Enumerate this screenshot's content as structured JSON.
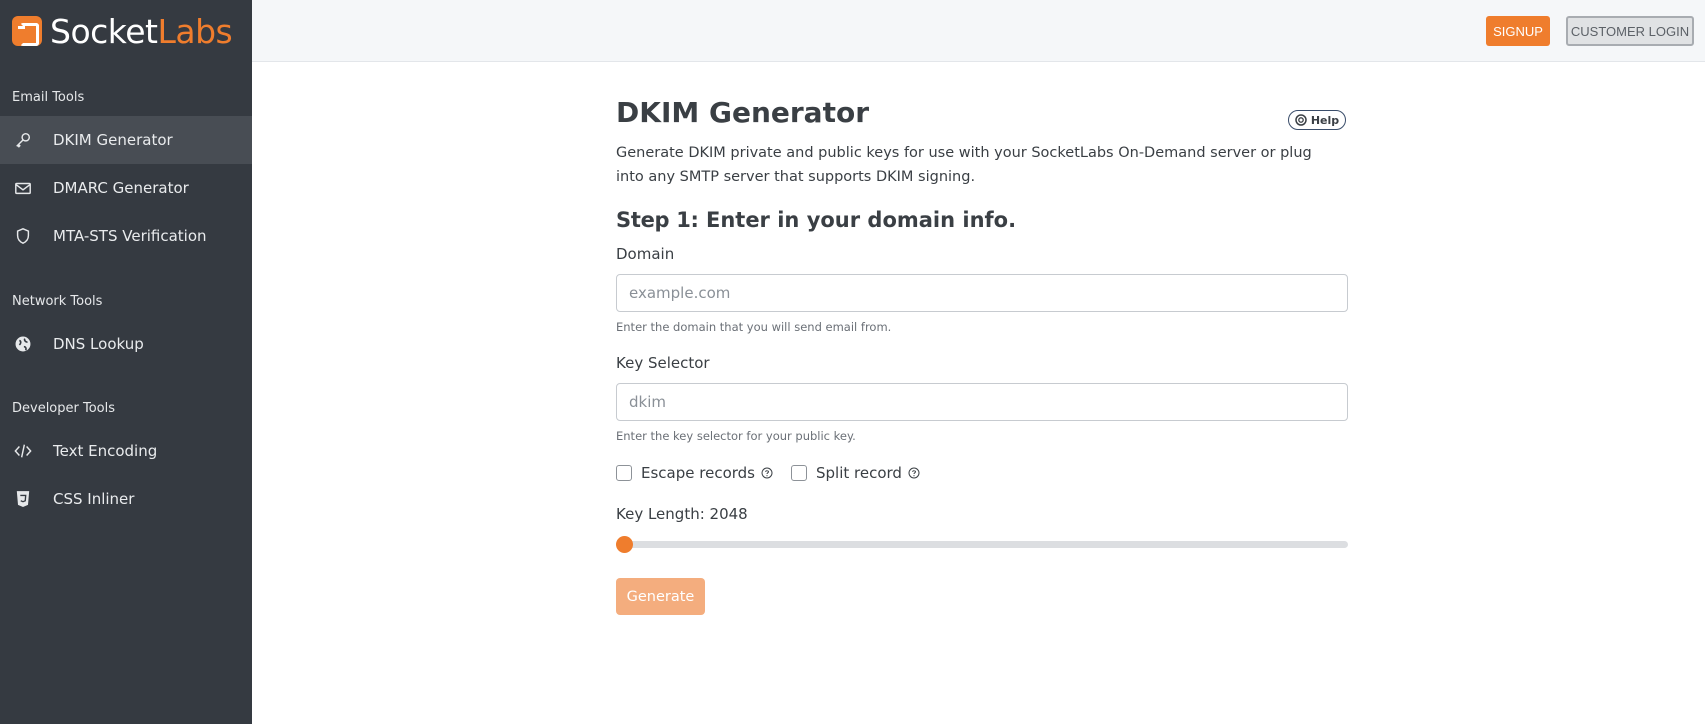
{
  "brand": {
    "name_part1": "Socket",
    "name_part2": "Labs"
  },
  "sidebar": {
    "sections": [
      {
        "title": "Email Tools",
        "items": [
          {
            "label": "DKIM Generator",
            "icon": "key-icon",
            "active": true
          },
          {
            "label": "DMARC Generator",
            "icon": "envelope-icon"
          },
          {
            "label": "MTA-STS Verification",
            "icon": "shield-icon"
          }
        ]
      },
      {
        "title": "Network Tools",
        "items": [
          {
            "label": "DNS Lookup",
            "icon": "globe-icon"
          }
        ]
      },
      {
        "title": "Developer Tools",
        "items": [
          {
            "label": "Text Encoding",
            "icon": "code-icon"
          },
          {
            "label": "CSS Inliner",
            "icon": "css3-icon"
          }
        ]
      }
    ]
  },
  "topbar": {
    "signup_label": "SIGNUP",
    "login_label": "CUSTOMER LOGIN"
  },
  "main": {
    "title": "DKIM Generator",
    "help_label": "Help",
    "intro": "Generate DKIM private and public keys for use with your SocketLabs On-Demand server or plug into any SMTP server that supports DKIM signing.",
    "step_number": "Step 1:",
    "step_text": "Enter in your domain info.",
    "domain": {
      "label": "Domain",
      "placeholder": "example.com",
      "value": "",
      "hint": "Enter the domain that you will send email from."
    },
    "selector": {
      "label": "Key Selector",
      "placeholder": "dkim",
      "value": "",
      "hint": "Enter the key selector for your public key."
    },
    "options": [
      {
        "label": "Escape records",
        "checked": false
      },
      {
        "label": "Split record",
        "checked": false
      }
    ],
    "key_length_label": "Key Length: 2048",
    "key_length_fraction": 0.0,
    "generate_label": "Generate"
  },
  "colors": {
    "accent": "#ef7d2d",
    "sidebar_bg": "#353a41",
    "sidebar_active": "#484d54"
  }
}
